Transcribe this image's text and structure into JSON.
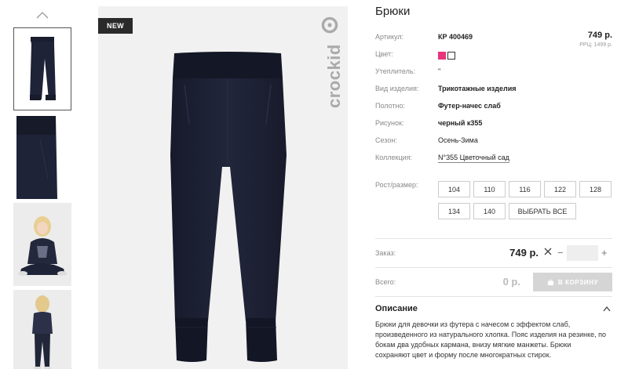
{
  "badge": "NEW",
  "brand": "crockid",
  "product": {
    "title": "Брюки",
    "price": "749 р.",
    "rrp": "РРЦ: 1499 р.",
    "colors": [
      "#e8347a",
      "#ffffff"
    ],
    "specs": [
      {
        "label": "Артикул:",
        "value": "КР 400469"
      },
      {
        "label": "Цвет:",
        "value": ""
      },
      {
        "label": "Утеплитель:",
        "value": "\""
      },
      {
        "label": "Вид изделия:",
        "value": "Трикотажные изделия"
      },
      {
        "label": "Полотно:",
        "value": "Футер-начес слаб"
      },
      {
        "label": "Рисунок:",
        "value": "черный к355"
      },
      {
        "label": "Сезон:",
        "value": "Осень-Зима"
      },
      {
        "label": "Коллекция:",
        "value": "N°355 Цветочный сад"
      }
    ]
  },
  "sizes": {
    "label": "Рост/размер:",
    "options": [
      "104",
      "110",
      "116",
      "122",
      "128",
      "134",
      "140"
    ],
    "select_all": "ВЫБРАТЬ ВСЕ"
  },
  "order": {
    "label": "Заказ:",
    "price": "749 р.",
    "quantity": ""
  },
  "total": {
    "label": "Всего:",
    "value": "0 р.",
    "cart_button": "В КОРЗИНУ"
  },
  "description": {
    "title": "Описание",
    "text": "Брюки для девочки из футера с начесом с эффектом слаб, произведенного из натурального хлопка. Пояс изделия на резинке, по бокам два удобных кармана, внизу мягкие манжеты. Брюки сохраняют цвет и форму после многократных стирок."
  },
  "icons": {
    "thumbs_up": "chevron-up-icon",
    "remove": "close-icon",
    "cart": "cart-icon",
    "collapse": "chevron-up-icon"
  }
}
